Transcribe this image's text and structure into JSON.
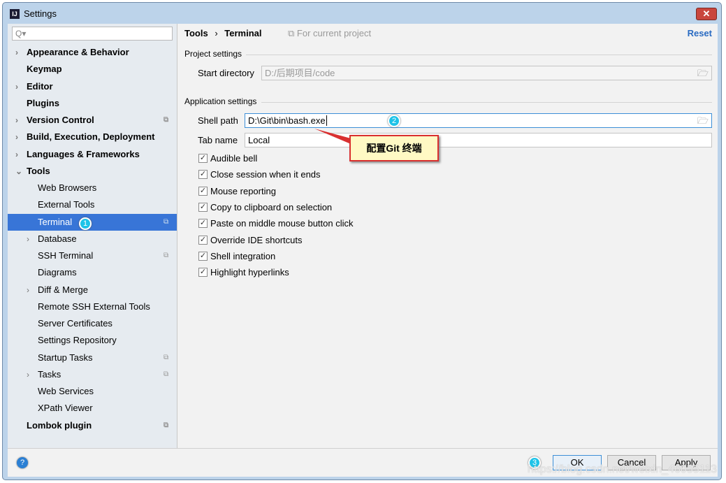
{
  "window": {
    "title": "Settings",
    "close": "✕"
  },
  "sidebar": {
    "search_placeholder": "Q▾",
    "items": [
      {
        "label": "Appearance & Behavior",
        "bold": true,
        "arrow": "›",
        "indent": 0
      },
      {
        "label": "Keymap",
        "bold": true,
        "indent": 0
      },
      {
        "label": "Editor",
        "bold": true,
        "arrow": "›",
        "indent": 0
      },
      {
        "label": "Plugins",
        "bold": true,
        "indent": 0
      },
      {
        "label": "Version Control",
        "bold": true,
        "arrow": "›",
        "indent": 0,
        "copy": true
      },
      {
        "label": "Build, Execution, Deployment",
        "bold": true,
        "arrow": "›",
        "indent": 0
      },
      {
        "label": "Languages & Frameworks",
        "bold": true,
        "arrow": "›",
        "indent": 0
      },
      {
        "label": "Tools",
        "bold": true,
        "arrow": "⌄",
        "indent": 0
      },
      {
        "label": "Web Browsers",
        "indent": 1
      },
      {
        "label": "External Tools",
        "indent": 1
      },
      {
        "label": "Terminal",
        "indent": 1,
        "selected": true,
        "copy": true
      },
      {
        "label": "Database",
        "indent": 1,
        "arrow": "›"
      },
      {
        "label": "SSH Terminal",
        "indent": 1,
        "copy": true
      },
      {
        "label": "Diagrams",
        "indent": 1
      },
      {
        "label": "Diff & Merge",
        "indent": 1,
        "arrow": "›"
      },
      {
        "label": "Remote SSH External Tools",
        "indent": 1
      },
      {
        "label": "Server Certificates",
        "indent": 1
      },
      {
        "label": "Settings Repository",
        "indent": 1
      },
      {
        "label": "Startup Tasks",
        "indent": 1,
        "copy": true
      },
      {
        "label": "Tasks",
        "indent": 1,
        "arrow": "›",
        "copy": true
      },
      {
        "label": "Web Services",
        "indent": 1
      },
      {
        "label": "XPath Viewer",
        "indent": 1
      },
      {
        "label": "Lombok plugin",
        "bold": true,
        "indent": 0,
        "copy": true
      }
    ]
  },
  "main": {
    "breadcrumb": {
      "parent": "Tools",
      "sep": "›",
      "current": "Terminal"
    },
    "scope": "⧉ For current project",
    "reset": "Reset",
    "project_section": "Project settings",
    "start_dir_label": "Start directory",
    "start_dir_value": "D:/后期项目/code",
    "app_section": "Application settings",
    "shell_path_label": "Shell path",
    "shell_path_value": "D:\\Git\\bin\\bash.exe",
    "tab_name_label": "Tab name",
    "tab_name_value": "Local",
    "checkboxes": [
      {
        "label": "Audible bell",
        "checked": true
      },
      {
        "label": "Close session when it ends",
        "checked": true
      },
      {
        "label": "Mouse reporting",
        "checked": true
      },
      {
        "label": "Copy to clipboard on selection",
        "checked": true
      },
      {
        "label": "Paste on middle mouse button click",
        "checked": true
      },
      {
        "label": "Override IDE shortcuts",
        "checked": true
      },
      {
        "label": "Shell integration",
        "checked": true
      },
      {
        "label": "Highlight hyperlinks",
        "checked": true
      }
    ]
  },
  "annotations": {
    "b1": "1",
    "b2": "2",
    "b3": "3",
    "callout": "配置Git 终端",
    "color": "#d93030"
  },
  "footer": {
    "help": "?",
    "ok": "OK",
    "cancel": "Cancel",
    "apply": "Apply"
  },
  "watermark": "https://blog.csdn.net/weixin_46055113"
}
